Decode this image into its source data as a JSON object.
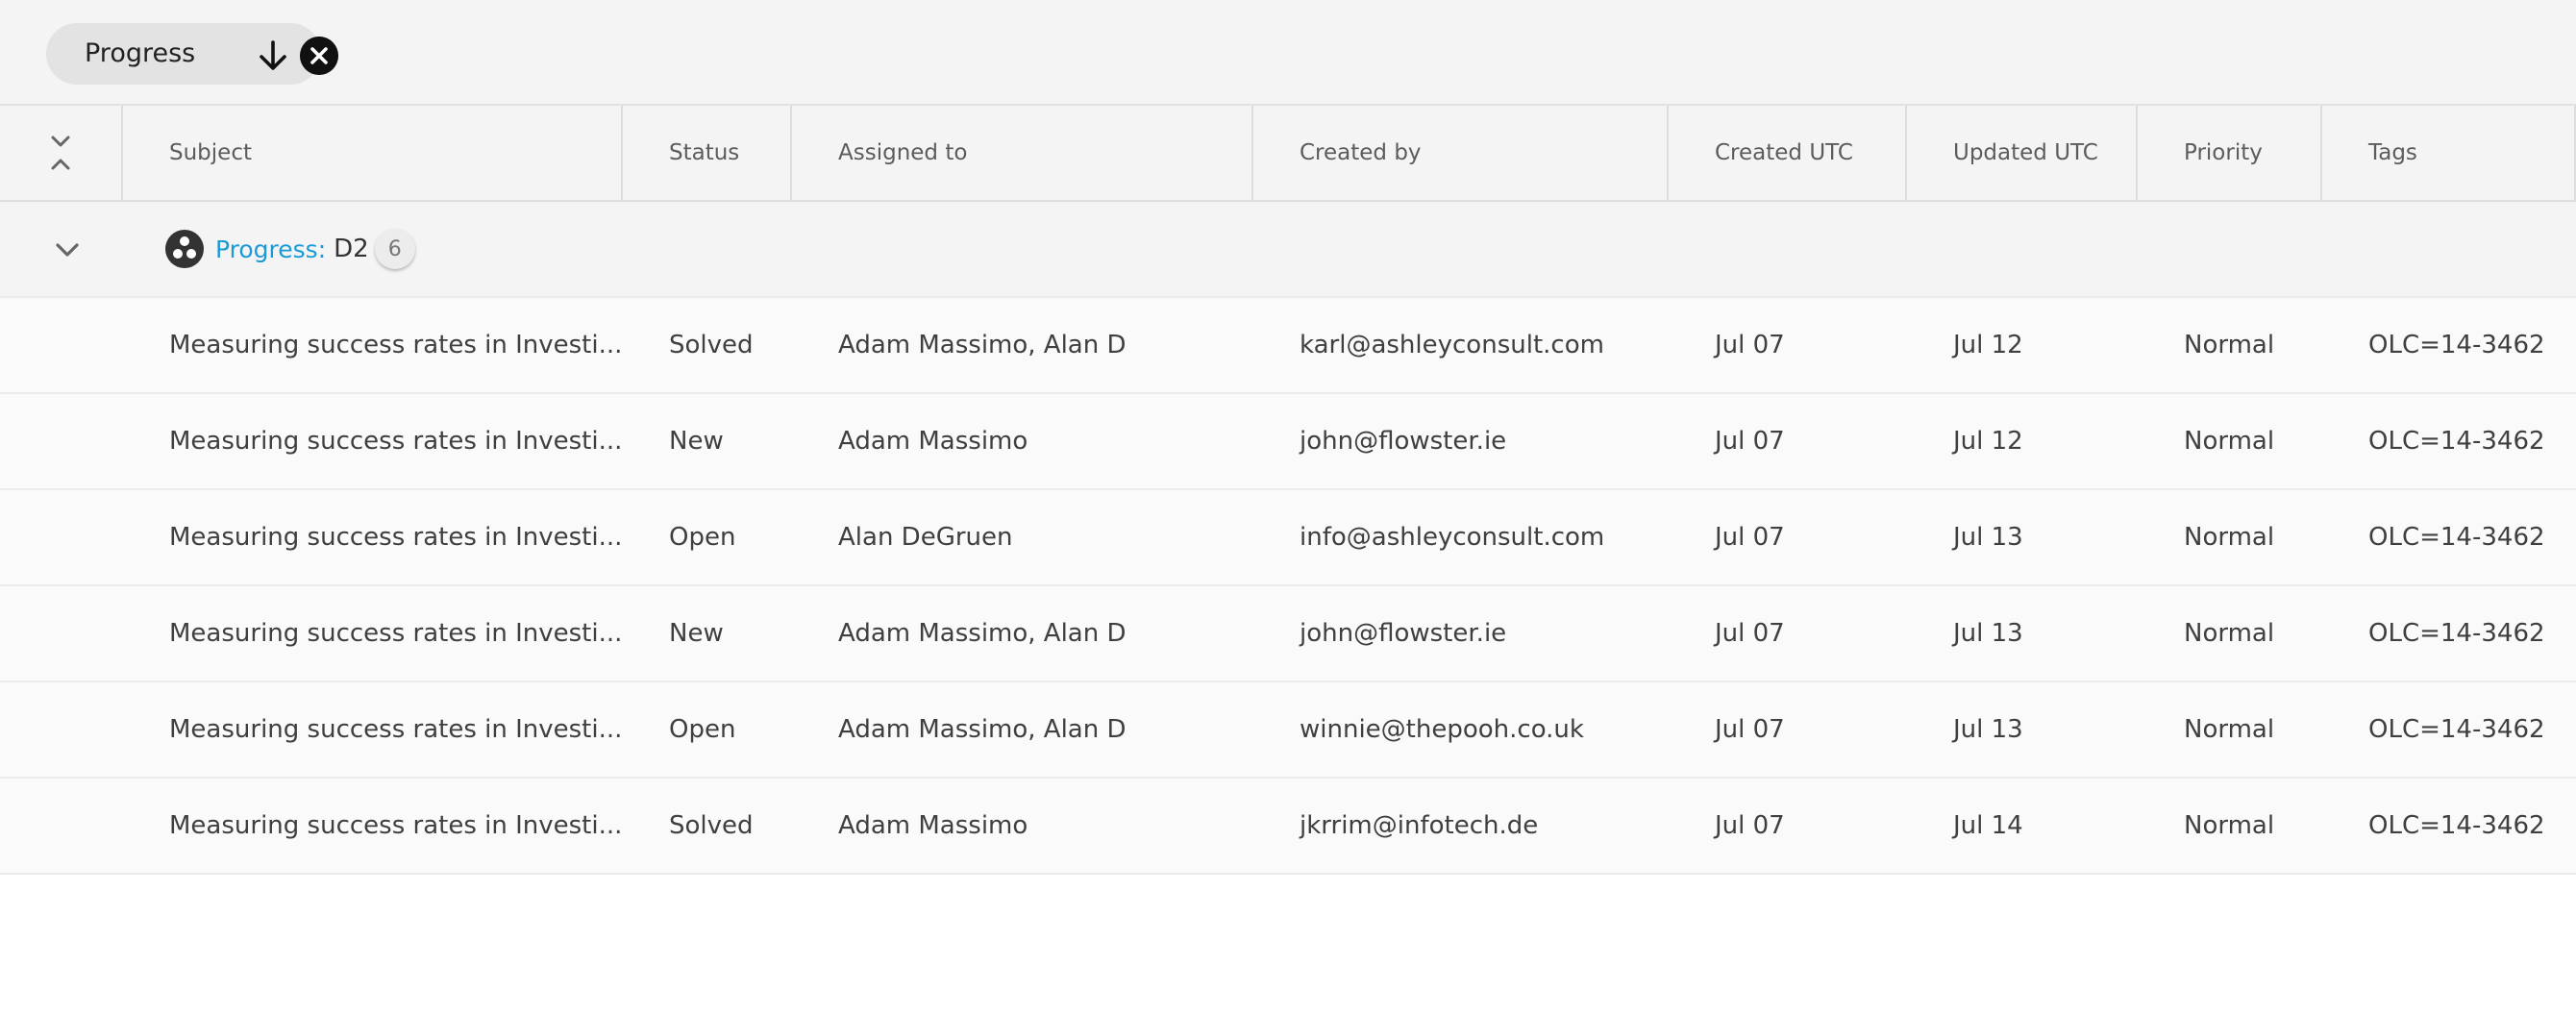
{
  "filter_chip": {
    "label": "Progress",
    "sort_icon": "arrow-down-icon",
    "remove_icon": "close-circle-icon"
  },
  "columns": {
    "toggle_icon": "collapse-all-icon",
    "subject": "Subject",
    "status": "Status",
    "assigned_to": "Assigned to",
    "created_by": "Created by",
    "created_utc": "Created UTC",
    "updated_utc": "Updated UTC",
    "priority": "Priority",
    "tags": "Tags"
  },
  "group": {
    "toggle_icon": "chevron-down-icon",
    "icon": "progress-icon",
    "label": "Progress:",
    "value": "D2",
    "count": "6"
  },
  "rows": [
    {
      "subject": "Measuring success rates in Investi...",
      "status": "Solved",
      "assigned_to": "Adam Massimo, Alan D",
      "created_by": "karl@ashleyconsult.com",
      "created_utc": "Jul 07",
      "updated_utc": "Jul 12",
      "priority": "Normal",
      "tags": "OLC=14-3462"
    },
    {
      "subject": "Measuring success rates in Investi...",
      "status": "New",
      "assigned_to": "Adam Massimo",
      "created_by": "john@flowster.ie",
      "created_utc": "Jul 07",
      "updated_utc": "Jul 12",
      "priority": "Normal",
      "tags": "OLC=14-3462"
    },
    {
      "subject": "Measuring success rates in Investi...",
      "status": "Open",
      "assigned_to": "Alan DeGruen",
      "created_by": "info@ashleyconsult.com",
      "created_utc": "Jul 07",
      "updated_utc": "Jul 13",
      "priority": "Normal",
      "tags": "OLC=14-3462"
    },
    {
      "subject": "Measuring success rates in Investi...",
      "status": "New",
      "assigned_to": "Adam Massimo, Alan D",
      "created_by": "john@flowster.ie",
      "created_utc": "Jul 07",
      "updated_utc": "Jul 13",
      "priority": "Normal",
      "tags": "OLC=14-3462"
    },
    {
      "subject": "Measuring success rates in Investi...",
      "status": "Open",
      "assigned_to": "Adam Massimo, Alan D",
      "created_by": "winnie@thepooh.co.uk",
      "created_utc": "Jul 07",
      "updated_utc": "Jul 13",
      "priority": "Normal",
      "tags": "OLC=14-3462"
    },
    {
      "subject": "Measuring success rates in Investi...",
      "status": "Solved",
      "assigned_to": "Adam Massimo",
      "created_by": "jkrrim@infotech.de",
      "created_utc": "Jul 07",
      "updated_utc": "Jul 14",
      "priority": "Normal",
      "tags": "OLC=14-3462"
    }
  ],
  "colors": {
    "accent": "#1a9ad6",
    "toolbar_bg": "#f4f4f4",
    "chip_bg": "#e3e3e3"
  }
}
